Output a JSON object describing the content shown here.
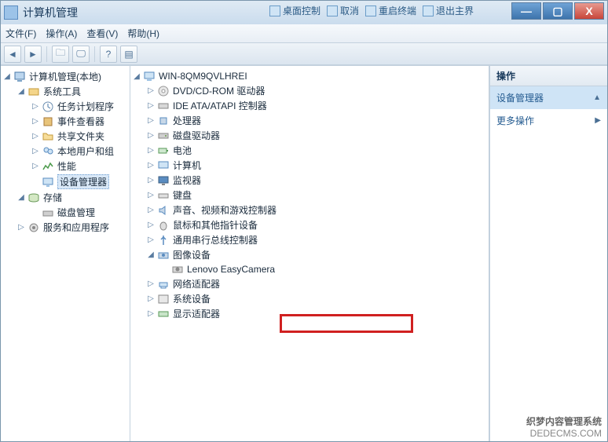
{
  "titlebar": {
    "title": "计算机管理"
  },
  "top_tools": [
    {
      "label": "桌面控制"
    },
    {
      "label": "取消"
    },
    {
      "label": "重启终端"
    },
    {
      "label": "退出主界"
    }
  ],
  "menubar": {
    "file": "文件(F)",
    "action": "操作(A)",
    "view": "查看(V)",
    "help": "帮助(H)"
  },
  "left_tree": {
    "root": "计算机管理(本地)",
    "system_tools": "系统工具",
    "task_scheduler": "任务计划程序",
    "event_viewer": "事件查看器",
    "shared_folders": "共享文件夹",
    "local_users": "本地用户和组",
    "performance": "性能",
    "device_manager": "设备管理器",
    "storage": "存储",
    "disk_mgmt": "磁盘管理",
    "services_apps": "服务和应用程序"
  },
  "device_tree": {
    "root": "WIN-8QM9QVLHREI",
    "dvd": "DVD/CD-ROM 驱动器",
    "ide": "IDE ATA/ATAPI 控制器",
    "cpu": "处理器",
    "disk_drive": "磁盘驱动器",
    "battery": "电池",
    "computer": "计算机",
    "monitor": "监视器",
    "keyboard": "键盘",
    "sound": "声音、视频和游戏控制器",
    "mouse": "鼠标和其他指针设备",
    "usb": "通用串行总线控制器",
    "imaging": "图像设备",
    "camera": "Lenovo EasyCamera",
    "network": "网络适配器",
    "system_dev": "系统设备",
    "display": "显示适配器"
  },
  "right_pane": {
    "header": "操作",
    "selected": "设备管理器",
    "more": "更多操作"
  },
  "watermark": {
    "line1": "织梦内容管理系统",
    "line2": "DEDECMS.COM"
  }
}
